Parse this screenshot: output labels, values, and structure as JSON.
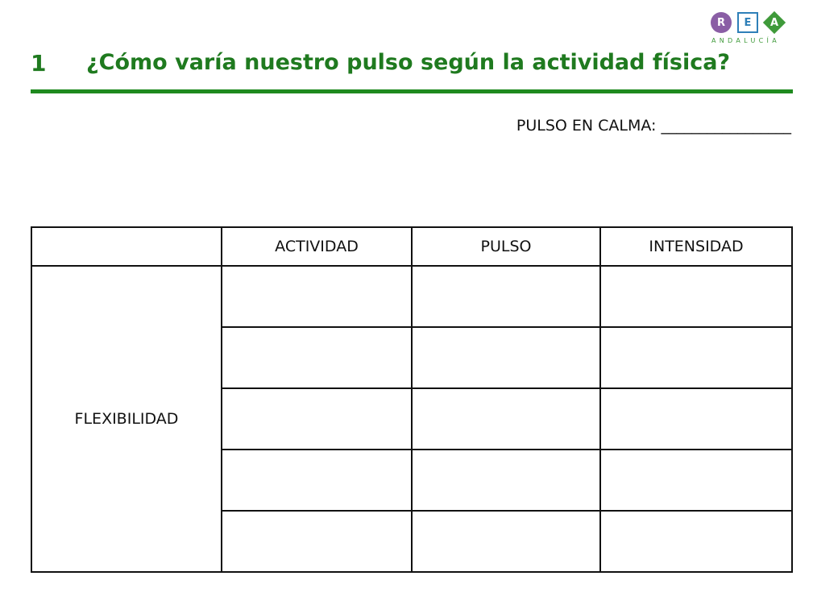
{
  "logo": {
    "letters": [
      "R",
      "E",
      "A"
    ],
    "subtitle": "ANDALUCÍA",
    "colors": {
      "r": "#8a5ea5",
      "e": "#2e7fb8",
      "a": "#3f9a3a"
    }
  },
  "heading": {
    "number": "1",
    "title": "¿Cómo varía nuestro pulso según la actividad física?",
    "color": "#1f7a1f"
  },
  "calm_pulse": {
    "label": "PULSO EN CALMA:",
    "blank": "_________________"
  },
  "table": {
    "headers": [
      "",
      "ACTIVIDAD",
      "PULSO",
      "INTENSIDAD"
    ],
    "row_label": "FLEXIBILIDAD",
    "rows": [
      [
        "",
        "",
        ""
      ],
      [
        "",
        "",
        ""
      ],
      [
        "",
        "",
        ""
      ],
      [
        "",
        "",
        ""
      ],
      [
        "",
        "",
        ""
      ]
    ]
  }
}
